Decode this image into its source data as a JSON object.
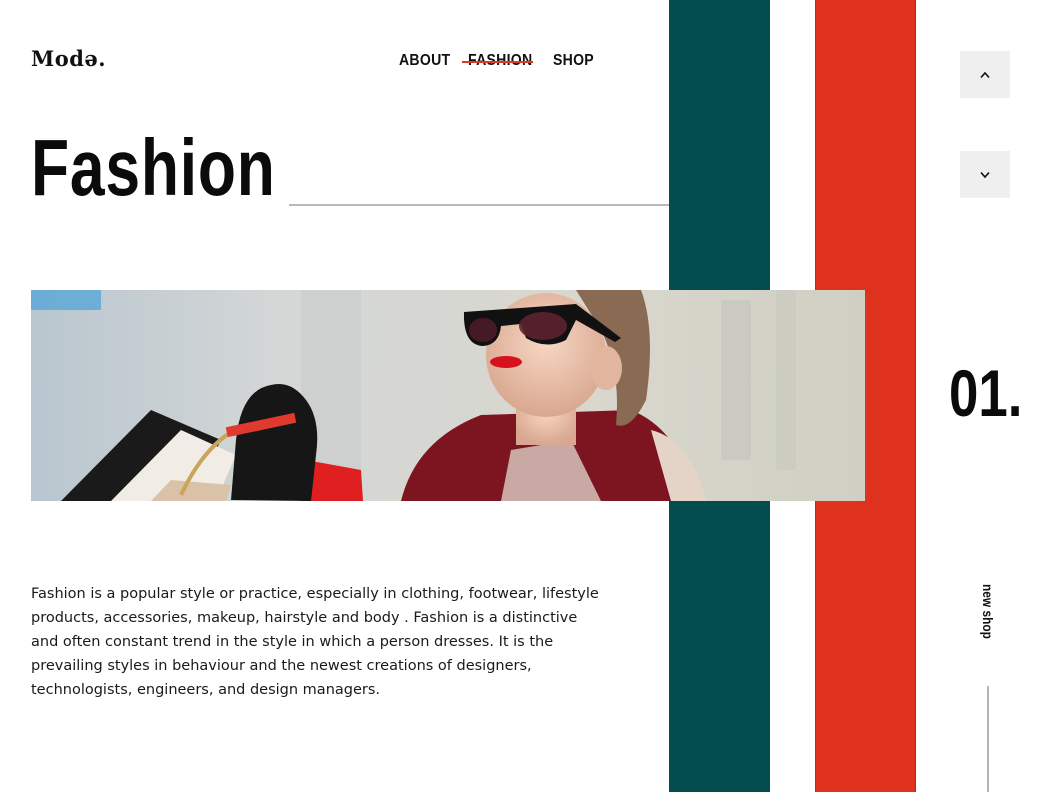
{
  "brand": {
    "logo_text": "Modə."
  },
  "nav": {
    "items": [
      {
        "label": "ABOUT"
      },
      {
        "label": "FASHION",
        "active": true
      },
      {
        "label": "SHOP"
      }
    ],
    "active_strike_color": "#de3a22"
  },
  "hero": {
    "title": "Fashion",
    "image_description_icon": "photo-woman-sunglasses-shopping-bags"
  },
  "sidebar": {
    "up_icon": "chevron-up-icon",
    "down_icon": "chevron-down-icon",
    "slide_number": "01.",
    "vertical_label": "new shop"
  },
  "content": {
    "description": "Fashion is a popular style or practice, especially in clothing, footwear, lifestyle products, accessories, makeup, hairstyle and body . Fashion is a distinctive and often constant trend in the style in which a person dresses. It is the prevailing styles in behaviour and the newest creations of designers, technologists, engineers, and design managers."
  },
  "colors": {
    "teal": "#044d4f",
    "red": "#df321e",
    "button_bg": "#efefef"
  }
}
